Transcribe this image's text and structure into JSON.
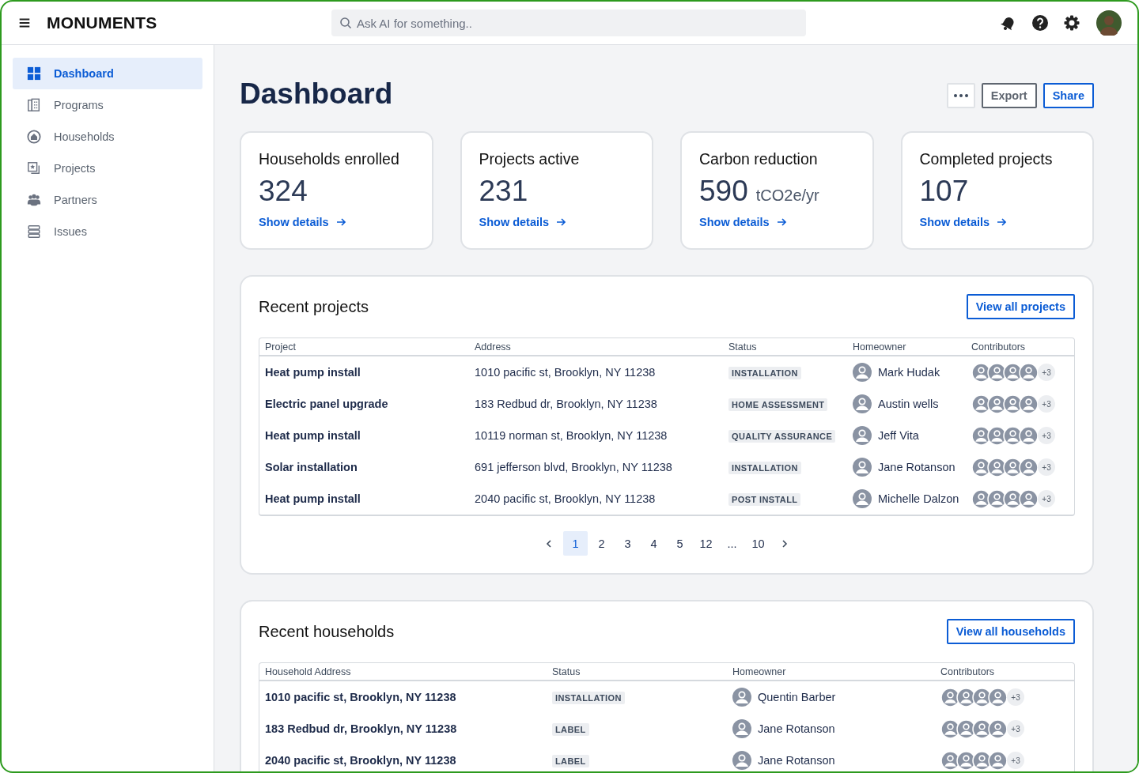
{
  "app": {
    "title": "MONUMENTS"
  },
  "search": {
    "placeholder": "Ask AI for something.."
  },
  "sidebar": {
    "items": [
      {
        "label": "Dashboard",
        "kind": "grid",
        "selected": true
      },
      {
        "label": "Programs",
        "kind": "building",
        "selected": false
      },
      {
        "label": "Households",
        "kind": "home",
        "selected": false
      },
      {
        "label": "Projects",
        "kind": "star",
        "selected": false
      },
      {
        "label": "Partners",
        "kind": "people",
        "selected": false
      },
      {
        "label": "Issues",
        "kind": "stack",
        "selected": false
      }
    ]
  },
  "page": {
    "title": "Dashboard",
    "actions": [
      {
        "kind": "more"
      },
      {
        "kind": "secondary",
        "label": "Export"
      },
      {
        "kind": "primary",
        "label": "Share"
      }
    ]
  },
  "stats": [
    {
      "title": "Households enrolled",
      "value": "324",
      "link": "Show details"
    },
    {
      "title": "Projects active",
      "value": "231",
      "link": "Show details"
    },
    {
      "title": "Carbon reduction",
      "value": "590",
      "unit": "tCO2e/yr",
      "link": "Show details"
    },
    {
      "title": "Completed projects",
      "value": "107",
      "link": "Show details"
    }
  ],
  "recent_projects": {
    "title": "Recent projects",
    "action": "View all projects",
    "columns": [
      "Project",
      "Address",
      "Status",
      "Homeowner",
      "Contributors"
    ],
    "rows": [
      {
        "project": "Heat pump install",
        "address": "1010 pacific st, Brooklyn, NY 11238",
        "status": "INSTALLATION",
        "homeowner": "Mark Hudak",
        "more": "+3"
      },
      {
        "project": "Electric panel upgrade",
        "address": "183 Redbud dr, Brooklyn, NY 11238",
        "status": "HOME ASSESSMENT",
        "homeowner": "Austin wells",
        "more": "+3"
      },
      {
        "project": "Heat pump install",
        "address": "10119 norman st, Brooklyn, NY 11238",
        "status": "QUALITY ASSURANCE",
        "homeowner": "Jeff Vita",
        "more": "+3"
      },
      {
        "project": "Solar installation",
        "address": "691 jefferson blvd, Brooklyn, NY 11238",
        "status": "INSTALLATION",
        "homeowner": "Jane Rotanson",
        "more": "+3"
      },
      {
        "project": "Heat pump install",
        "address": "2040 pacific st, Brooklyn, NY 11238",
        "status": "POST INSTALL",
        "homeowner": "Michelle Dalzon",
        "more": "+3"
      }
    ],
    "pagination": [
      {
        "label": "1",
        "selected": true
      },
      {
        "label": "2",
        "selected": false
      },
      {
        "label": "3",
        "selected": false
      },
      {
        "label": "4",
        "selected": false
      },
      {
        "label": "5",
        "selected": false
      },
      {
        "label": "12",
        "selected": false
      },
      {
        "label": "...",
        "selected": false
      },
      {
        "label": "10",
        "selected": false
      }
    ]
  },
  "recent_households": {
    "title": "Recent households",
    "action": "View all households",
    "columns": [
      "Household Address",
      "Status",
      "Homeowner",
      "Contributors"
    ],
    "rows": [
      {
        "address": "1010 pacific st, Brooklyn, NY 11238",
        "status": "INSTALLATION",
        "homeowner": "Quentin Barber",
        "more": "+3"
      },
      {
        "address": "183 Redbud dr, Brooklyn, NY 11238",
        "status": "LABEL",
        "homeowner": "Jane Rotanson",
        "more": "+3"
      },
      {
        "address": "2040 pacific st, Brooklyn, NY 11238",
        "status": "LABEL",
        "homeowner": "Jane Rotanson",
        "more": "+3"
      }
    ]
  }
}
